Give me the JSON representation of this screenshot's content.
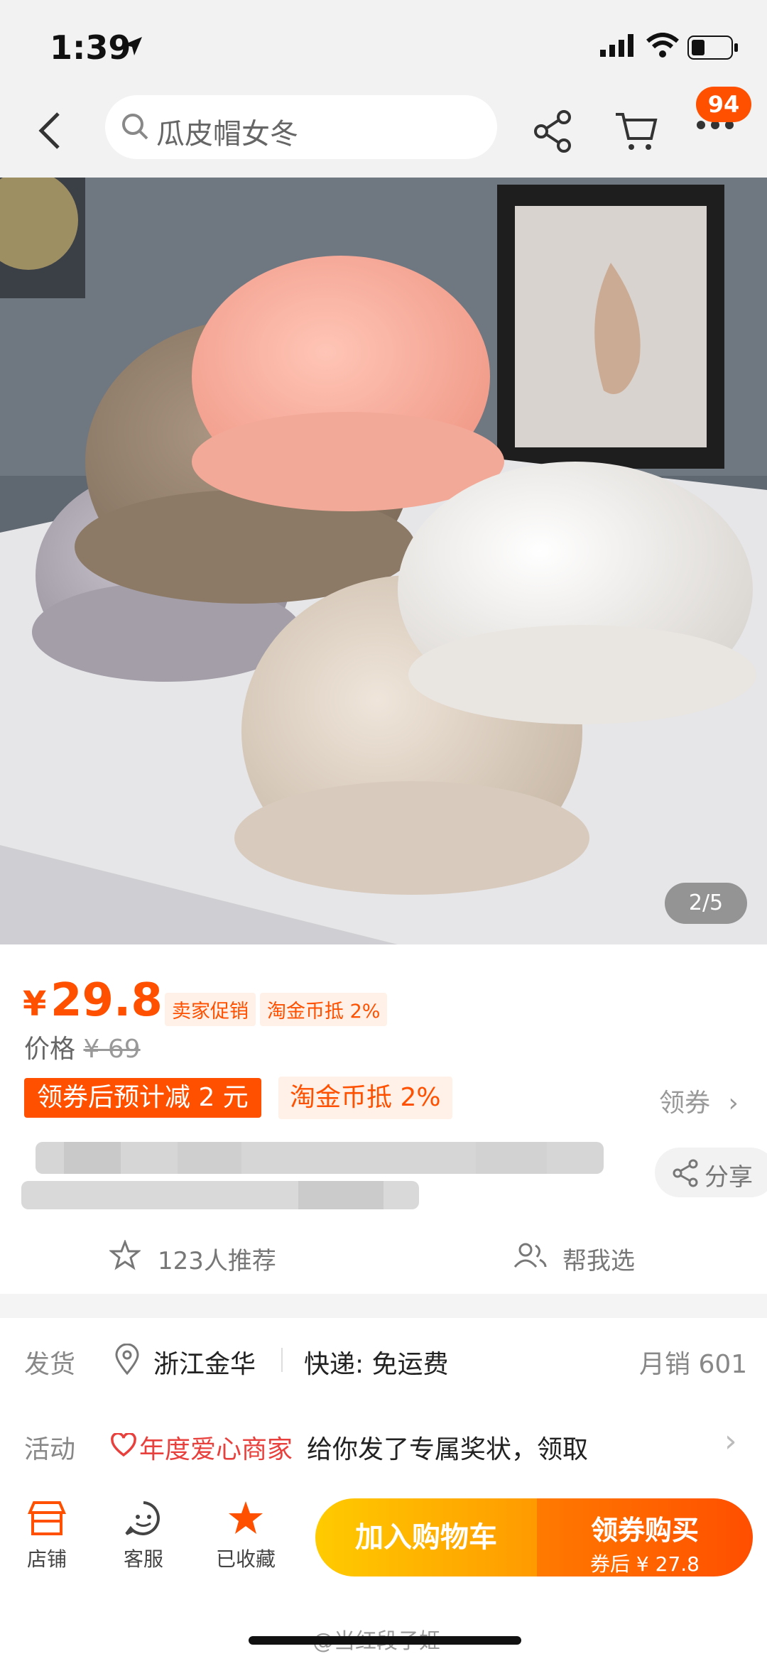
{
  "status": {
    "time": "1:39"
  },
  "search": {
    "placeholder": "瓜皮帽女冬"
  },
  "cart_badge": "94",
  "gallery": {
    "counter": "2/5"
  },
  "price": {
    "currency": "¥",
    "value": "29.8",
    "tags": [
      "卖家促销",
      "淘金币抵 2%"
    ],
    "original_label": "价格",
    "original_value": "¥ 69"
  },
  "coupon": {
    "main": "领券后预计减 2 元",
    "coin": "淘金币抵 2%",
    "get": "领券"
  },
  "title": {
    "share": "分享"
  },
  "social": {
    "recommend": "123人推荐",
    "help": "帮我选"
  },
  "shipping": {
    "label": "发货",
    "from": "浙江金华",
    "express": "快递: 免运费",
    "sales": "月销 601"
  },
  "activity": {
    "label": "活动",
    "highlight": "年度爱心商家",
    "text": "给你发了专属奖状，领取"
  },
  "bottom": {
    "store": "店铺",
    "service": "客服",
    "favorite": "已收藏",
    "add_cart": "加入购物车",
    "buy_main": "领券购买",
    "buy_sub": "券后 ¥ 27.8"
  },
  "watermark": "@当红段子姬",
  "colors": {
    "accent": "#ff5000",
    "yellow": "#ffb400",
    "heart": "#e8413d"
  }
}
